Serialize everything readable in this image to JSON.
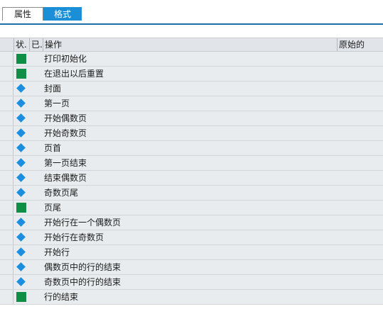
{
  "tabs": [
    {
      "label": "属性",
      "active": false
    },
    {
      "label": "格式",
      "active": true
    }
  ],
  "table": {
    "columns": {
      "status": "状.",
      "done": "已.",
      "action": "操作",
      "original": "原始的"
    },
    "rows": [
      {
        "label": "打印初始化",
        "icon": "green-square-icon"
      },
      {
        "label": "在退出以后重置",
        "icon": "green-square-icon"
      },
      {
        "label": "封面",
        "icon": "blue-diamond-icon"
      },
      {
        "label": "第一页",
        "icon": "blue-diamond-icon"
      },
      {
        "label": "开始偶数页",
        "icon": "blue-diamond-icon"
      },
      {
        "label": "开始奇数页",
        "icon": "blue-diamond-icon"
      },
      {
        "label": "页首",
        "icon": "blue-diamond-icon"
      },
      {
        "label": "第一页结束",
        "icon": "blue-diamond-icon"
      },
      {
        "label": "结束偶数页",
        "icon": "blue-diamond-icon"
      },
      {
        "label": "奇数页尾",
        "icon": "blue-diamond-icon"
      },
      {
        "label": "页尾",
        "icon": "green-square-icon"
      },
      {
        "label": "开始行在一个偶数页",
        "icon": "blue-diamond-icon"
      },
      {
        "label": "开始行在奇数页",
        "icon": "blue-diamond-icon"
      },
      {
        "label": "开始行",
        "icon": "blue-diamond-icon"
      },
      {
        "label": "偶数页中的行的结束",
        "icon": "blue-diamond-icon"
      },
      {
        "label": "奇数页中的行的结束",
        "icon": "blue-diamond-icon"
      },
      {
        "label": "行的结束",
        "icon": "green-square-icon"
      }
    ]
  },
  "colors": {
    "tab_active": "#1a8fd8",
    "status_green": "#0f8f46",
    "status_blue": "#1c8ee0",
    "row_background": "#e8ecef"
  }
}
